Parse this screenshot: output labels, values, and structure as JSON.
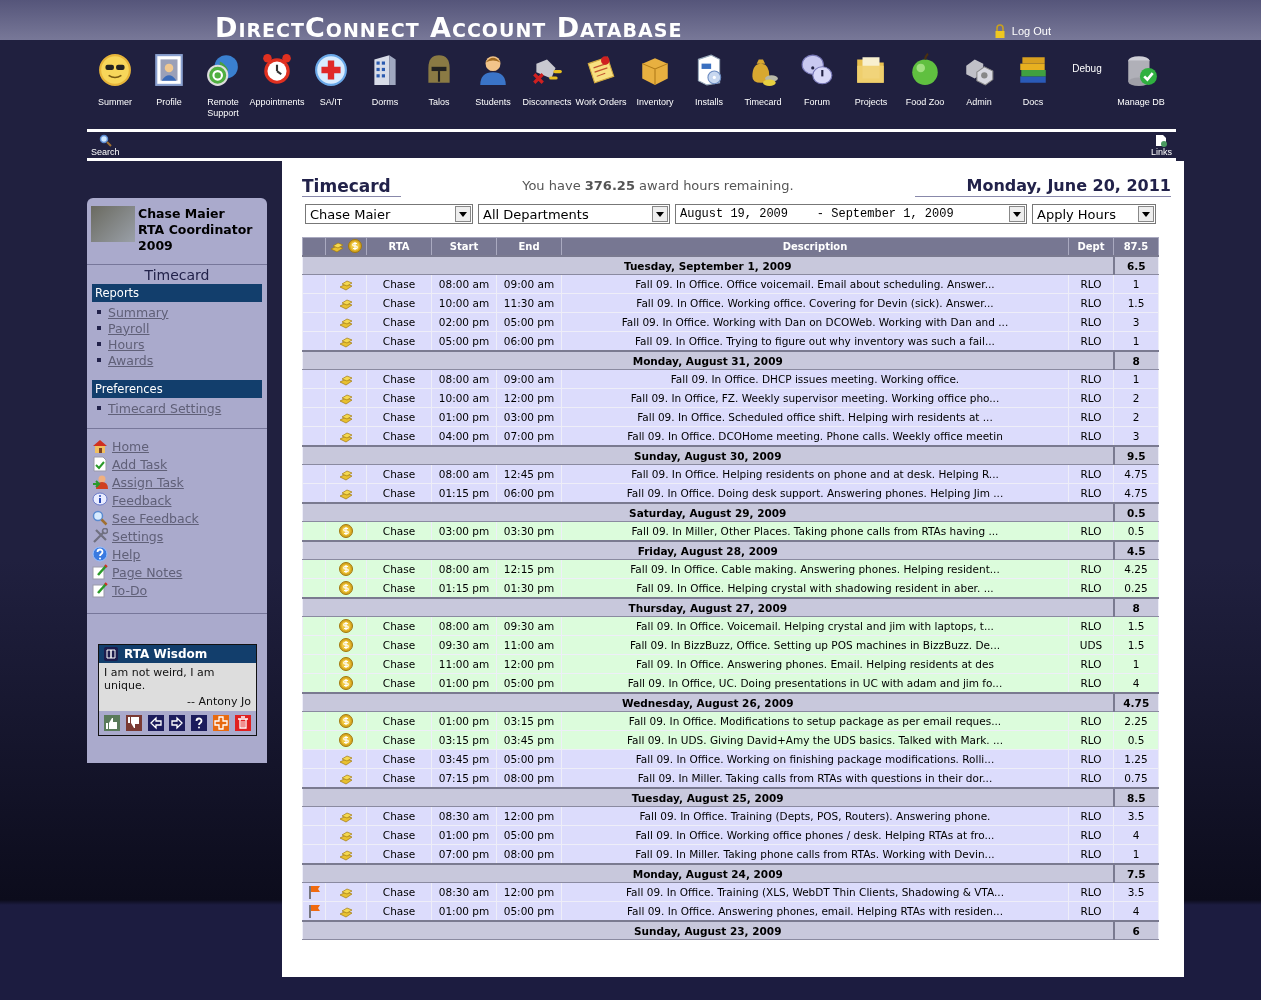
{
  "app": {
    "title": "DirectConnect Account Database",
    "logout": "Log Out"
  },
  "toolbar": [
    {
      "label": "Summer",
      "kind": "icon"
    },
    {
      "label": "Profile",
      "kind": "icon"
    },
    {
      "label": "Remote Support",
      "kind": "icon"
    },
    {
      "label": "Appointments",
      "kind": "icon"
    },
    {
      "label": "SA/IT",
      "kind": "icon"
    },
    {
      "label": "Dorms",
      "kind": "icon"
    },
    {
      "label": "Talos",
      "kind": "icon"
    },
    {
      "label": "Students",
      "kind": "icon"
    },
    {
      "label": "Disconnects",
      "kind": "icon"
    },
    {
      "label": "Work Orders",
      "kind": "icon"
    },
    {
      "label": "Inventory",
      "kind": "icon"
    },
    {
      "label": "Installs",
      "kind": "icon"
    },
    {
      "label": "Timecard",
      "kind": "icon"
    },
    {
      "label": "Forum",
      "kind": "icon"
    },
    {
      "label": "Projects",
      "kind": "icon"
    },
    {
      "label": "Food Zoo",
      "kind": "icon"
    },
    {
      "label": "Admin",
      "kind": "icon"
    },
    {
      "label": "Docs",
      "kind": "icon"
    },
    {
      "label": "Debug",
      "kind": "text"
    },
    {
      "label": "Manage DB",
      "kind": "icon"
    }
  ],
  "quickbar": [
    {
      "label": "Search"
    },
    {
      "label": "Links"
    }
  ],
  "sidebar": {
    "user": {
      "name": "Chase Maier",
      "role": "RTA Coordinator",
      "year": "2009"
    },
    "title": "Timecard",
    "sections": [
      {
        "heading": "Reports",
        "links": [
          "Summary",
          "Payroll",
          "Hours",
          "Awards"
        ]
      },
      {
        "heading": "Preferences",
        "links": [
          "Timecard Settings"
        ]
      }
    ],
    "links": [
      "Home",
      "Add Task",
      "Assign Task",
      "Feedback",
      "See Feedback",
      "Settings",
      "Help",
      "Page Notes",
      "To-Do"
    ],
    "wisdom": {
      "title": "RTA Wisdom",
      "quote": "I am not weird, I am unique.",
      "author": "-- Antony Jo"
    }
  },
  "timecard": {
    "title": "Timecard",
    "award_note": "You have **376.25** award hours remaining.",
    "date": "Monday, June 20, 2011",
    "filters": [
      "Chase Maier",
      "All Departments",
      "August 19, 2009    - September 1, 2009",
      "Apply Hours"
    ],
    "columns": [
      "RTA",
      "Start",
      "End",
      "Description",
      "Dept",
      "87.5"
    ],
    "days": [
      {
        "date": "Tuesday, September 1, 2009",
        "total": "6.5",
        "entries": [
          {
            "kind": "award",
            "flagged": false,
            "rta": "Chase",
            "start": "08:00 am",
            "end": "09:00 am",
            "description": "Fall 09. In Office. Office voicemail. Email about scheduling. Answer...",
            "dept": "RLO",
            "hours": "1"
          },
          {
            "kind": "award",
            "flagged": false,
            "rta": "Chase",
            "start": "10:00 am",
            "end": "11:30 am",
            "description": "Fall 09. In Office. Working office. Covering for Devin (sick). Answer...",
            "dept": "RLO",
            "hours": "1.5"
          },
          {
            "kind": "award",
            "flagged": false,
            "rta": "Chase",
            "start": "02:00 pm",
            "end": "05:00 pm",
            "description": "Fall 09. In Office. Working with Dan on DCOWeb. Working with Dan and ...",
            "dept": "RLO",
            "hours": "3"
          },
          {
            "kind": "award",
            "flagged": false,
            "rta": "Chase",
            "start": "05:00 pm",
            "end": "06:00 pm",
            "description": "Fall 09. In Office. Trying to figure out why inventory was such a fail...",
            "dept": "RLO",
            "hours": "1"
          }
        ]
      },
      {
        "date": "Monday, August 31, 2009",
        "total": "8",
        "entries": [
          {
            "kind": "award",
            "flagged": false,
            "rta": "Chase",
            "start": "08:00 am",
            "end": "09:00 am",
            "description": "Fall 09. In Office. DHCP issues meeting. Working office.",
            "dept": "RLO",
            "hours": "1"
          },
          {
            "kind": "award",
            "flagged": false,
            "rta": "Chase",
            "start": "10:00 am",
            "end": "12:00 pm",
            "description": "Fall 09. In Office, FZ. Weekly supervisor meeting. Working office pho...",
            "dept": "RLO",
            "hours": "2"
          },
          {
            "kind": "award",
            "flagged": false,
            "rta": "Chase",
            "start": "01:00 pm",
            "end": "03:00 pm",
            "description": "Fall 09. In Office. Scheduled office shift. Helping wirh residents at ...",
            "dept": "RLO",
            "hours": "2"
          },
          {
            "kind": "award",
            "flagged": false,
            "rta": "Chase",
            "start": "04:00 pm",
            "end": "07:00 pm",
            "description": "Fall 09. In Office. DCOHome meeting. Phone calls. Weekly office meetin",
            "dept": "RLO",
            "hours": "3"
          }
        ]
      },
      {
        "date": "Sunday, August 30, 2009",
        "total": "9.5",
        "entries": [
          {
            "kind": "award",
            "flagged": false,
            "rta": "Chase",
            "start": "08:00 am",
            "end": "12:45 pm",
            "description": "Fall 09. In Office. Helping residents on phone and at desk. Helping R...",
            "dept": "RLO",
            "hours": "4.75"
          },
          {
            "kind": "award",
            "flagged": false,
            "rta": "Chase",
            "start": "01:15 pm",
            "end": "06:00 pm",
            "description": "Fall 09. In Office. Doing desk support. Answering phones. Helping Jim ...",
            "dept": "RLO",
            "hours": "4.75"
          }
        ]
      },
      {
        "date": "Saturday, August 29, 2009",
        "total": "0.5",
        "entries": [
          {
            "kind": "paid",
            "flagged": false,
            "rta": "Chase",
            "start": "03:00 pm",
            "end": "03:30 pm",
            "description": "Fall 09. In Miller, Other Places. Taking phone calls from RTAs having ...",
            "dept": "RLO",
            "hours": "0.5"
          }
        ]
      },
      {
        "date": "Friday, August 28, 2009",
        "total": "4.5",
        "entries": [
          {
            "kind": "paid",
            "flagged": false,
            "rta": "Chase",
            "start": "08:00 am",
            "end": "12:15 pm",
            "description": "Fall 09. In Office. Cable making. Answering phones. Helping resident...",
            "dept": "RLO",
            "hours": "4.25"
          },
          {
            "kind": "paid",
            "flagged": false,
            "rta": "Chase",
            "start": "01:15 pm",
            "end": "01:30 pm",
            "description": "Fall 09. In Office. Helping crystal with shadowing resident in aber. ...",
            "dept": "RLO",
            "hours": "0.25"
          }
        ]
      },
      {
        "date": "Thursday, August 27, 2009",
        "total": "8",
        "entries": [
          {
            "kind": "paid",
            "flagged": false,
            "rta": "Chase",
            "start": "08:00 am",
            "end": "09:30 am",
            "description": "Fall 09. In Office. Voicemail. Helping crystal and jim with laptops, t...",
            "dept": "RLO",
            "hours": "1.5"
          },
          {
            "kind": "paid",
            "flagged": false,
            "rta": "Chase",
            "start": "09:30 am",
            "end": "11:00 am",
            "description": "Fall 09. In BizzBuzz, Office. Setting up POS machines in BizzBuzz. De...",
            "dept": "UDS",
            "hours": "1.5"
          },
          {
            "kind": "paid",
            "flagged": false,
            "rta": "Chase",
            "start": "11:00 am",
            "end": "12:00 pm",
            "description": "Fall 09. In Office. Answering phones. Email. Helping residents at des",
            "dept": "RLO",
            "hours": "1"
          },
          {
            "kind": "paid",
            "flagged": false,
            "rta": "Chase",
            "start": "01:00 pm",
            "end": "05:00 pm",
            "description": "Fall 09. In Office, UC. Doing presentations in UC with adam and jim fo...",
            "dept": "RLO",
            "hours": "4"
          }
        ]
      },
      {
        "date": "Wednesday, August 26, 2009",
        "total": "4.75",
        "entries": [
          {
            "kind": "paid",
            "flagged": false,
            "rta": "Chase",
            "start": "01:00 pm",
            "end": "03:15 pm",
            "description": "Fall 09. In Office. Modifications to setup package as per email reques...",
            "dept": "RLO",
            "hours": "2.25"
          },
          {
            "kind": "paid",
            "flagged": false,
            "rta": "Chase",
            "start": "03:15 pm",
            "end": "03:45 pm",
            "description": "Fall 09. In UDS. Giving David+Amy the UDS basics. Talked with Mark. ...",
            "dept": "RLO",
            "hours": "0.5"
          },
          {
            "kind": "award",
            "flagged": false,
            "rta": "Chase",
            "start": "03:45 pm",
            "end": "05:00 pm",
            "description": "Fall 09. In Office. Working on finishing package modifications. Rolli...",
            "dept": "RLO",
            "hours": "1.25"
          },
          {
            "kind": "award",
            "flagged": false,
            "rta": "Chase",
            "start": "07:15 pm",
            "end": "08:00 pm",
            "description": "Fall 09. In Miller. Taking calls from RTAs with questions in their dor...",
            "dept": "RLO",
            "hours": "0.75"
          }
        ]
      },
      {
        "date": "Tuesday, August 25, 2009",
        "total": "8.5",
        "entries": [
          {
            "kind": "award",
            "flagged": false,
            "rta": "Chase",
            "start": "08:30 am",
            "end": "12:00 pm",
            "description": "Fall 09. In Office. Training (Depts, POS, Routers). Answering phone.",
            "dept": "RLO",
            "hours": "3.5"
          },
          {
            "kind": "award",
            "flagged": false,
            "rta": "Chase",
            "start": "01:00 pm",
            "end": "05:00 pm",
            "description": "Fall 09. In Office. Working office phones / desk. Helping RTAs at fro...",
            "dept": "RLO",
            "hours": "4"
          },
          {
            "kind": "award",
            "flagged": false,
            "rta": "Chase",
            "start": "07:00 pm",
            "end": "08:00 pm",
            "description": "Fall 09. In Miller. Taking phone calls from RTAs. Working with Devin...",
            "dept": "RLO",
            "hours": "1"
          }
        ]
      },
      {
        "date": "Monday, August 24, 2009",
        "total": "7.5",
        "entries": [
          {
            "kind": "award",
            "flagged": true,
            "rta": "Chase",
            "start": "08:30 am",
            "end": "12:00 pm",
            "description": "Fall 09. In Office. Training (XLS, WebDT Thin Clients, Shadowing & VTA...",
            "dept": "RLO",
            "hours": "3.5"
          },
          {
            "kind": "award",
            "flagged": true,
            "rta": "Chase",
            "start": "01:00 pm",
            "end": "05:00 pm",
            "description": "Fall 09. In Office. Answering phones, email. Helping RTAs with residen...",
            "dept": "RLO",
            "hours": "4"
          }
        ]
      },
      {
        "date": "Sunday, August 23, 2009",
        "total": "6"
      }
    ]
  }
}
